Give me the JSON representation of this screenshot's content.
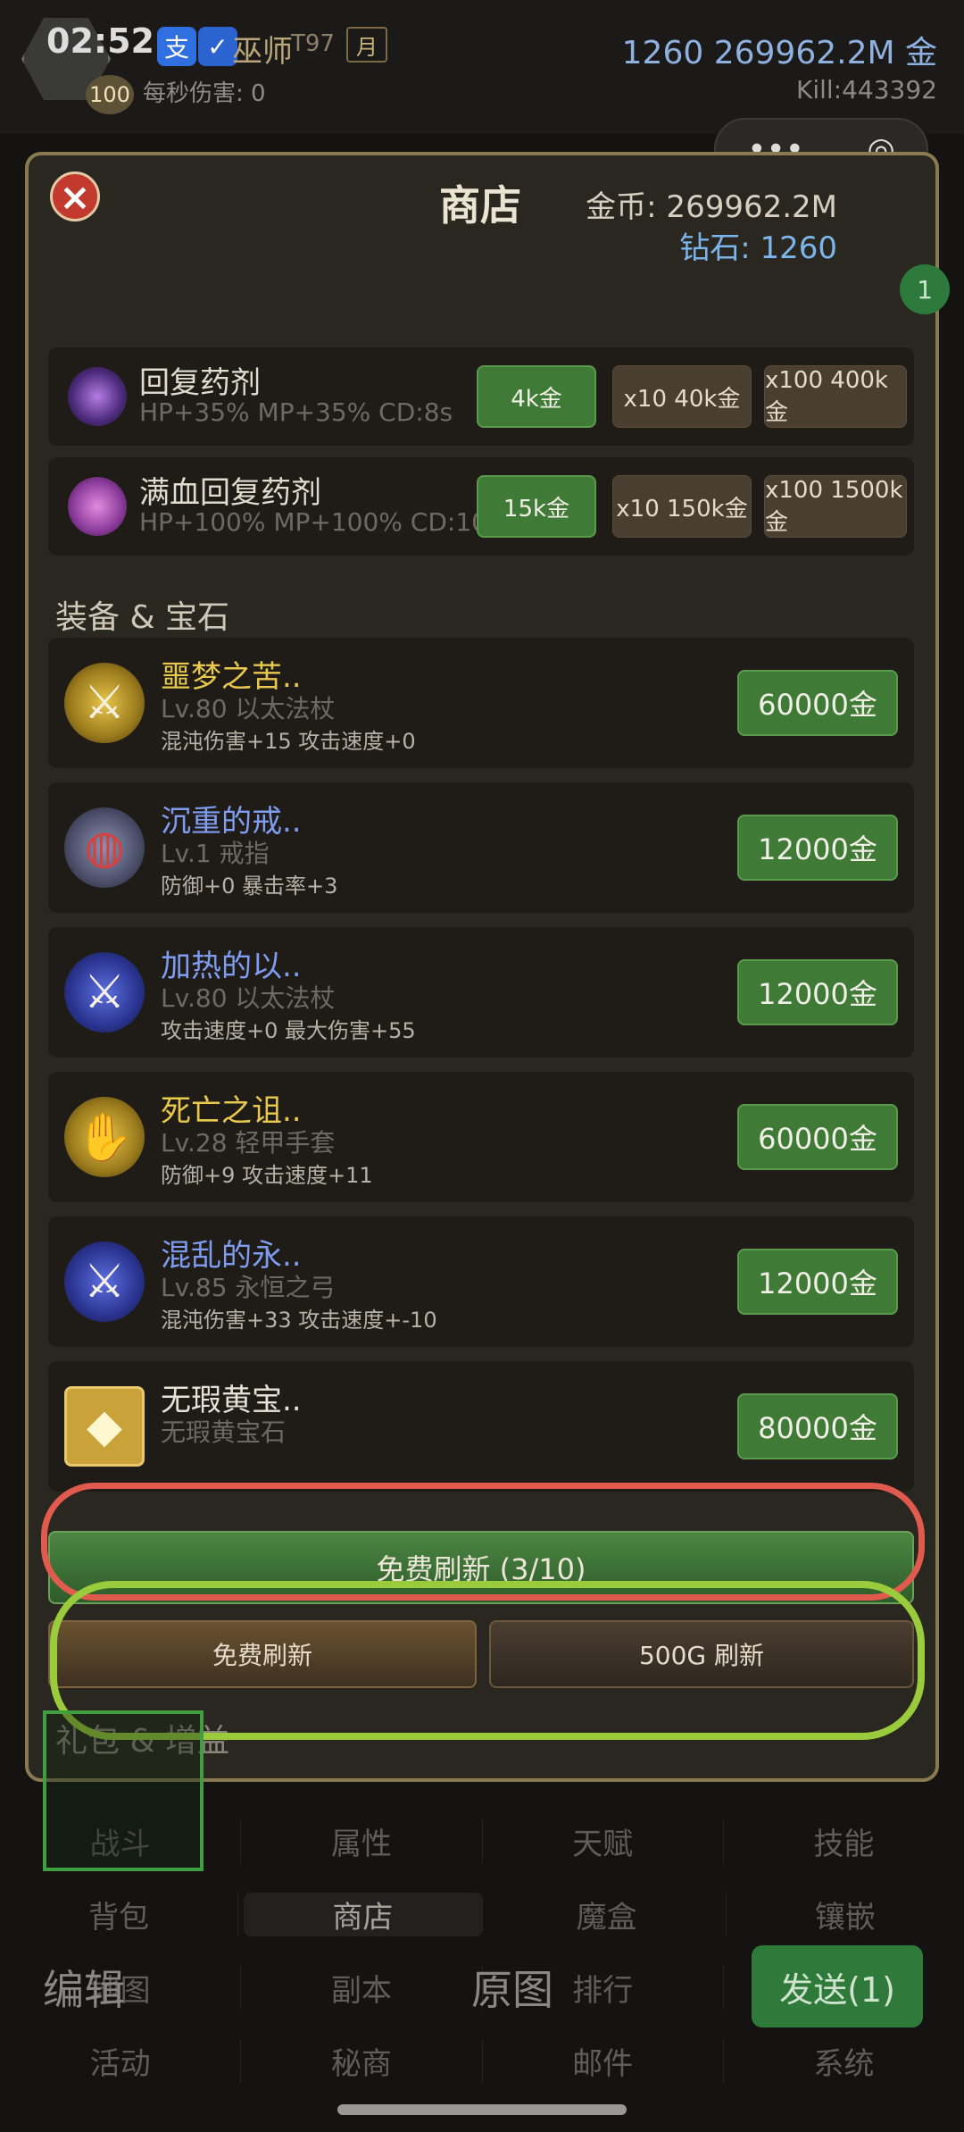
{
  "hud": {
    "time": "02:52",
    "level": "100",
    "hero_name": "巫师",
    "tier": "T97",
    "month_badge": "月",
    "dps": "每秒伤害: 0",
    "top_right": "1260 269962.2M 金",
    "kill": "Kill:443392",
    "alipay": "支"
  },
  "shop": {
    "title": "商店",
    "gold_label": "金币: 269962.2M",
    "diamond_label": "钻石: 1260",
    "badge": "1",
    "potions": [
      {
        "name": "回复药剂",
        "desc": "HP+35% MP+35%  CD:8s",
        "btn1": "4k金",
        "btn2": "x10 40k金",
        "btn3": "x100 400k金"
      },
      {
        "name": "满血回复药剂",
        "desc": "HP+100% MP+100%  CD:10s",
        "btn1": "15k金",
        "btn2": "x10 150k金",
        "btn3": "x100 1500k金"
      }
    ],
    "equip_section": "装备 & 宝石",
    "items": [
      {
        "name": "噩梦之苦..",
        "type": "Lv.80 以太法杖",
        "stats": "混沌伤害+15 攻击速度+0",
        "price": "60000金"
      },
      {
        "name": "沉重的戒..",
        "type": "Lv.1 戒指",
        "stats": "防御+0 暴击率+3",
        "price": "12000金"
      },
      {
        "name": "加热的以..",
        "type": "Lv.80 以太法杖",
        "stats": "攻击速度+0 最大伤害+55",
        "price": "12000金"
      },
      {
        "name": "死亡之诅..",
        "type": "Lv.28 轻甲手套",
        "stats": "防御+9 攻击速度+11",
        "price": "60000金"
      },
      {
        "name": "混乱的永..",
        "type": "Lv.85 永恒之弓",
        "stats": "混沌伤害+33 攻击速度+-10",
        "price": "12000金"
      },
      {
        "name": "无瑕黄宝..",
        "type": "无瑕黄宝石",
        "stats": "",
        "price": "80000金"
      }
    ],
    "refresh_free_count": "免费刷新 (3/10)",
    "refresh_free": "免费刷新",
    "refresh_paid": "500G 刷新",
    "gift_section": "礼包 & 增益"
  },
  "tabs": {
    "row1": [
      "战斗",
      "属性",
      "天赋",
      "技能"
    ],
    "row2": [
      "背包",
      "商店",
      "魔盒",
      "镶嵌"
    ],
    "row3": [
      "地图",
      "副本",
      "排行",
      ""
    ],
    "row4": [
      "活动",
      "秘商",
      "邮件",
      "系统"
    ]
  },
  "editor": {
    "edit": "编辑",
    "original": "原图",
    "send": "发送(1)"
  },
  "colors": {
    "accent_green": "#3f7a36",
    "annotation_red": "#e05a4e",
    "annotation_green": "#9acb3c",
    "name_yellow": "#e9c94d",
    "name_blue": "#7f9cf0"
  }
}
